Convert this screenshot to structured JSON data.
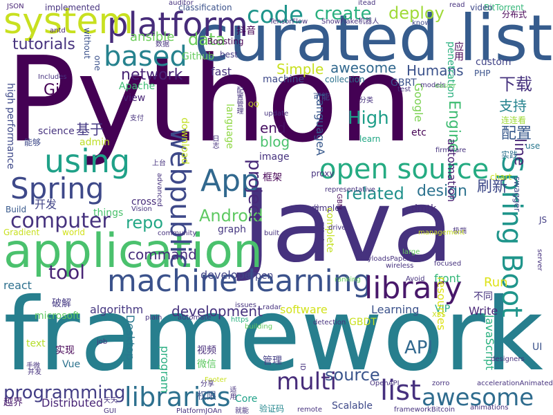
{
  "words": [
    {
      "text": "Python",
      "color": "#440154"
    },
    {
      "text": "Java",
      "color": "#46327e"
    },
    {
      "text": "framework",
      "color": "#277f8e"
    },
    {
      "text": "curated list",
      "color": "#365c8d"
    },
    {
      "text": "application",
      "color": "#4ac16d"
    },
    {
      "text": "machine learning",
      "color": "#3b528b"
    },
    {
      "text": "platform",
      "color": "#472c7a"
    },
    {
      "text": "system",
      "color": "#c8e020"
    },
    {
      "text": "code",
      "color": "#1f958b"
    },
    {
      "text": "create",
      "color": "#2ab07f"
    },
    {
      "text": "deploy",
      "color": "#a0da39"
    },
    {
      "text": "based",
      "color": "#26828e"
    },
    {
      "text": "tutorials",
      "color": "#46327e"
    },
    {
      "text": "data",
      "color": "#6ccd5a"
    },
    {
      "text": "ansible",
      "color": "#6ccd5a"
    },
    {
      "text": "Github",
      "color": "#65cb5e"
    },
    {
      "text": "network",
      "color": "#482475"
    },
    {
      "text": "using",
      "color": "#1fa188"
    },
    {
      "text": "Spring",
      "color": "#3e4989"
    },
    {
      "text": "App",
      "color": "#31688e"
    },
    {
      "text": "webpublic",
      "color": "#3e4989"
    },
    {
      "text": "open source",
      "color": "#25ab82"
    },
    {
      "text": "library",
      "color": "#48186a"
    },
    {
      "text": "Spring Boot",
      "color": "#1f958b"
    },
    {
      "text": "computer",
      "color": "#46327e"
    },
    {
      "text": "repo",
      "color": "#22a785"
    },
    {
      "text": "Android",
      "color": "#5ec962"
    },
    {
      "text": "project",
      "color": "#482878"
    },
    {
      "text": "related",
      "color": "#21918c"
    },
    {
      "text": "design",
      "color": "#2c728e"
    },
    {
      "text": "刷新",
      "color": "#3e4989"
    },
    {
      "text": "下载",
      "color": "#46327e"
    },
    {
      "text": "支持",
      "color": "#25838e"
    },
    {
      "text": "配置",
      "color": "#38598c"
    },
    {
      "text": "High",
      "color": "#1f9e89"
    },
    {
      "text": "end",
      "color": "#471063"
    },
    {
      "text": "blog",
      "color": "#4ac16d"
    },
    {
      "text": "Simple",
      "color": "#c8e020"
    },
    {
      "text": "awesome",
      "color": "#31688e"
    },
    {
      "text": "Humans",
      "color": "#3b528b"
    },
    {
      "text": "custom",
      "color": "#414487"
    },
    {
      "text": "fast",
      "color": "#46327e"
    },
    {
      "text": "Git",
      "color": "#440154"
    },
    {
      "text": "Apache",
      "color": "#3dbc74"
    },
    {
      "text": "view",
      "color": "#482475"
    },
    {
      "text": "基于",
      "color": "#443983"
    },
    {
      "text": "science",
      "color": "#46327e"
    },
    {
      "text": "admin",
      "color": "#bddf26"
    },
    {
      "text": "tool",
      "color": "#482475"
    },
    {
      "text": "command",
      "color": "#472d7b"
    },
    {
      "text": "developer",
      "color": "#414487"
    },
    {
      "text": "development",
      "color": "#46327e"
    },
    {
      "text": "algorithm",
      "color": "#453781"
    },
    {
      "text": "react",
      "color": "#2d708e"
    },
    {
      "text": "microsoft",
      "color": "#5ec962"
    },
    {
      "text": "software",
      "color": "#d2e21b"
    },
    {
      "text": "Learning",
      "color": "#3b528b"
    },
    {
      "text": "Write",
      "color": "#482576"
    },
    {
      "text": "Run",
      "color": "#dde318"
    },
    {
      "text": "front",
      "color": "#35b779"
    },
    {
      "text": "API",
      "color": "#31688e"
    },
    {
      "text": "multi",
      "color": "#472c7a"
    },
    {
      "text": "libraries",
      "color": "#2d708e"
    },
    {
      "text": "source",
      "color": "#3a548c"
    },
    {
      "text": "list",
      "color": "#46307e"
    },
    {
      "text": "awesome",
      "color": "#2f6c8e"
    },
    {
      "text": "programming",
      "color": "#433e85"
    },
    {
      "text": "Distributed",
      "color": "#482576"
    },
    {
      "text": "Scalable",
      "color": "#3e4989"
    },
    {
      "text": "实现",
      "color": "#440154"
    },
    {
      "text": "视频",
      "color": "#472c7a"
    },
    {
      "text": "微信",
      "color": "#5ec962"
    },
    {
      "text": "管理",
      "color": "#433e85"
    },
    {
      "text": "越界",
      "color": "#48186a"
    },
    {
      "text": "权限",
      "color": "#3b528b"
    },
    {
      "text": "验证码",
      "color": "#24878e"
    },
    {
      "text": "开发",
      "color": "#414487"
    },
    {
      "text": "Vue",
      "color": "#2c728e"
    },
    {
      "text": "text",
      "color": "#b5de2b"
    },
    {
      "text": "Core",
      "color": "#1fa188"
    },
    {
      "text": "Open",
      "color": "#414487"
    },
    {
      "text": "VIP",
      "color": "#25ab82"
    },
    {
      "text": "破解",
      "color": "#443983"
    },
    {
      "text": "不同",
      "color": "#46327e"
    },
    {
      "text": "UI",
      "color": "#3b528b"
    },
    {
      "text": "JavaScript",
      "color": "#2ab07f"
    },
    {
      "text": "resources",
      "color": "#dde318"
    },
    {
      "text": "Desktop",
      "color": "#2a788e"
    },
    {
      "text": "program",
      "color": "#28ae80"
    },
    {
      "text": "line",
      "color": "#482475"
    },
    {
      "text": "Engine",
      "color": "#3fbc73"
    },
    {
      "text": "Google",
      "color": "#7ad151"
    },
    {
      "text": "etc",
      "color": "#440154"
    },
    {
      "text": "automation",
      "color": "#481f70"
    },
    {
      "text": "use",
      "color": "#2a788e"
    },
    {
      "text": "learn",
      "color": "#22a785"
    },
    {
      "text": "image",
      "color": "#46327e"
    },
    {
      "text": "LanguageA",
      "color": "#38598c"
    },
    {
      "text": "language",
      "color": "#8fd744"
    },
    {
      "text": "download",
      "color": "#c2df23"
    },
    {
      "text": "high performance",
      "color": "#3e4989"
    },
    {
      "text": "能够",
      "color": "#3e4989"
    },
    {
      "text": "cross",
      "color": "#472c7a"
    },
    {
      "text": "things",
      "color": "#4ac16d"
    },
    {
      "text": "graph",
      "color": "#453781"
    },
    {
      "text": "Build",
      "color": "#38598c"
    },
    {
      "text": "world",
      "color": "#d2e21b"
    },
    {
      "text": "Gradient",
      "color": "#c8e020"
    },
    {
      "text": "dmtk",
      "color": "#472c7a"
    },
    {
      "text": "JS",
      "color": "#433e85"
    },
    {
      "text": "GBRT",
      "color": "#3b528b"
    },
    {
      "text": "BitTorrent",
      "color": "#35b779"
    },
    {
      "text": "分布式",
      "color": "#440154"
    },
    {
      "text": "连连看",
      "color": "#a0da39"
    },
    {
      "text": "实践",
      "color": "#2c728e"
    },
    {
      "text": "PHP",
      "color": "#3b528b"
    },
    {
      "text": "可能",
      "color": "#3b528b"
    },
    {
      "text": "machine",
      "color": "#3e4989"
    },
    {
      "text": "collection",
      "color": "#2c728e"
    },
    {
      "text": "best",
      "color": "#443983"
    },
    {
      "text": "Boosting",
      "color": "#440154"
    },
    {
      "text": "抖音",
      "color": "#440154"
    },
    {
      "text": "without",
      "color": "#3b528b"
    },
    {
      "text": "one",
      "color": "#3b528b"
    },
    {
      "text": "implemented",
      "color": "#46327e"
    },
    {
      "text": "classification",
      "color": "#3b528b"
    },
    {
      "text": "video",
      "color": "#3e4989"
    },
    {
      "text": "JSON",
      "color": "#482475"
    },
    {
      "text": "antd",
      "color": "#482475"
    },
    {
      "text": "auditor",
      "color": "#46327e"
    },
    {
      "text": "itead",
      "color": "#46327e"
    },
    {
      "text": "read",
      "color": "#46327e"
    },
    {
      "text": "know",
      "color": "#3e4989"
    },
    {
      "text": "TensorFlow",
      "color": "#46327e"
    },
    {
      "text": "SnowFlake机器人",
      "color": "#46327e"
    },
    {
      "text": "penetration",
      "color": "#2ab07f"
    },
    {
      "text": "应用",
      "color": "#440154"
    },
    {
      "text": "models",
      "color": "#46327e"
    },
    {
      "text": "easier",
      "color": "#65cb5e"
    },
    {
      "text": "firmware",
      "color": "#46327e"
    },
    {
      "text": "chart",
      "color": "#c8e020"
    },
    {
      "text": "swagger",
      "color": "#3e4989"
    },
    {
      "text": "框架",
      "color": "#440154"
    },
    {
      "text": "proxy",
      "color": "#46327e"
    },
    {
      "text": "GBM",
      "color": "#440154"
    },
    {
      "text": "examples",
      "color": "#46327e"
    },
    {
      "text": "complete",
      "color": "#c2df23"
    },
    {
      "text": "Flink",
      "color": "#46327e"
    },
    {
      "text": "PayloadsPapers",
      "color": "#46327e"
    },
    {
      "text": "ranking",
      "color": "#65cb5e"
    },
    {
      "text": "Avoid",
      "color": "#46327e"
    },
    {
      "text": "built",
      "color": "#46327e"
    },
    {
      "text": "large",
      "color": "#65cb5e"
    },
    {
      "text": "wireless",
      "color": "#46327e"
    },
    {
      "text": "focused",
      "color": "#46327e"
    },
    {
      "text": "server",
      "color": "#46327e"
    },
    {
      "text": "极端",
      "color": "#46327e"
    },
    {
      "text": "management",
      "color": "#c8e020"
    },
    {
      "text": "driven",
      "color": "#46327e"
    },
    {
      "text": "community",
      "color": "#46327e"
    },
    {
      "text": "Vision",
      "color": "#46327e"
    },
    {
      "text": "advanced",
      "color": "#46327e"
    },
    {
      "text": "Includes",
      "color": "#46327e"
    },
    {
      "text": "automate",
      "color": "#46327e"
    },
    {
      "text": "building",
      "color": "#65cb5e"
    },
    {
      "text": "plain",
      "color": "#46327e"
    },
    {
      "text": "detection",
      "color": "#46327e"
    },
    {
      "text": "https",
      "color": "#2ab07f"
    },
    {
      "text": "GBDT",
      "color": "#c8e020"
    },
    {
      "text": "XSS",
      "color": "#c8e020"
    },
    {
      "text": "radar",
      "color": "#46327e"
    },
    {
      "text": "issues",
      "color": "#46327e"
    },
    {
      "text": "update",
      "color": "#46327e"
    },
    {
      "text": "配置管理",
      "color": "#46327e"
    },
    {
      "text": "QQ",
      "color": "#c8e020"
    },
    {
      "text": "分类",
      "color": "#46327e"
    },
    {
      "text": "手微",
      "color": "#46327e"
    },
    {
      "text": "支付",
      "color": "#46327e"
    },
    {
      "text": "日志",
      "color": "#46327e"
    },
    {
      "text": "上台",
      "color": "#46327e"
    },
    {
      "text": "数据",
      "color": "#46327e"
    },
    {
      "text": "Footer",
      "color": "#c8e020"
    },
    {
      "text": "job",
      "color": "#46327e"
    },
    {
      "text": "ID",
      "color": "#46327e"
    },
    {
      "text": "OpenAPI",
      "color": "#46327e"
    },
    {
      "text": "zorro",
      "color": "#46327e"
    },
    {
      "text": "designers",
      "color": "#46327e"
    },
    {
      "text": "accelerationAnimated",
      "color": "#46327e"
    },
    {
      "text": "animations",
      "color": "#46327e"
    },
    {
      "text": "remote",
      "color": "#46327e"
    },
    {
      "text": "frameworkBitcoin",
      "color": "#46327e"
    },
    {
      "text": "PlatformJOAn",
      "color": "#46327e"
    },
    {
      "text": "适用",
      "color": "#46327e"
    },
    {
      "text": "就能",
      "color": "#46327e"
    },
    {
      "text": "分享",
      "color": "#46327e"
    },
    {
      "text": "并发",
      "color": "#46327e"
    },
    {
      "text": "天天",
      "color": "#46327e"
    },
    {
      "text": "GUI",
      "color": "#46327e"
    },
    {
      "text": "representative",
      "color": "#46327e"
    },
    {
      "text": "分块",
      "color": "#46327e"
    },
    {
      "text": "test",
      "color": "#46327e"
    }
  ]
}
